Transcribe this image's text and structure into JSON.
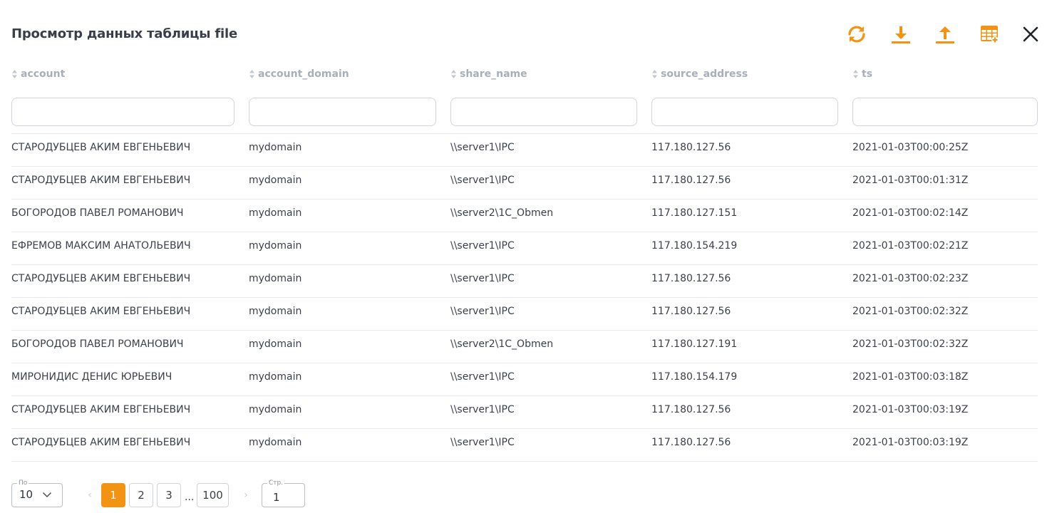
{
  "title": "Просмотр данных таблицы file",
  "toolbar": {
    "icons": [
      "refresh-icon",
      "download-icon",
      "upload-icon",
      "table-add-icon",
      "close-icon"
    ],
    "accent": "#f39314"
  },
  "columns": [
    "account",
    "account_domain",
    "share_name",
    "source_address",
    "ts"
  ],
  "rows": [
    [
      "СТАРОДУБЦЕВ АКИМ ЕВГЕНЬЕВИЧ",
      "mydomain",
      "\\\\server1\\IPC",
      "117.180.127.56",
      "2021-01-03T00:00:25Z"
    ],
    [
      "СТАРОДУБЦЕВ АКИМ ЕВГЕНЬЕВИЧ",
      "mydomain",
      "\\\\server1\\IPC",
      "117.180.127.56",
      "2021-01-03T00:01:31Z"
    ],
    [
      "БОГОРОДОВ ПАВЕЛ РОМАНОВИЧ",
      "mydomain",
      "\\\\server2\\1C_Obmen",
      "117.180.127.151",
      "2021-01-03T00:02:14Z"
    ],
    [
      "ЕФРЕМОВ МАКСИМ АНАТОЛЬЕВИЧ",
      "mydomain",
      "\\\\server1\\IPC",
      "117.180.154.219",
      "2021-01-03T00:02:21Z"
    ],
    [
      "СТАРОДУБЦЕВ АКИМ ЕВГЕНЬЕВИЧ",
      "mydomain",
      "\\\\server1\\IPC",
      "117.180.127.56",
      "2021-01-03T00:02:23Z"
    ],
    [
      "СТАРОДУБЦЕВ АКИМ ЕВГЕНЬЕВИЧ",
      "mydomain",
      "\\\\server1\\IPC",
      "117.180.127.56",
      "2021-01-03T00:02:32Z"
    ],
    [
      "БОГОРОДОВ ПАВЕЛ РОМАНОВИЧ",
      "mydomain",
      "\\\\server2\\1C_Obmen",
      "117.180.127.191",
      "2021-01-03T00:02:32Z"
    ],
    [
      "МИРОНИДИС ДЕНИС ЮРЬЕВИЧ",
      "mydomain",
      "\\\\server1\\IPC",
      "117.180.154.179",
      "2021-01-03T00:03:18Z"
    ],
    [
      "СТАРОДУБЦЕВ АКИМ ЕВГЕНЬЕВИЧ",
      "mydomain",
      "\\\\server1\\IPC",
      "117.180.127.56",
      "2021-01-03T00:03:19Z"
    ],
    [
      "СТАРОДУБЦЕВ АКИМ ЕВГЕНЬЕВИЧ",
      "mydomain",
      "\\\\server1\\IPC",
      "117.180.127.56",
      "2021-01-03T00:03:19Z"
    ]
  ],
  "pagination": {
    "per_page_label": "По",
    "per_page_value": "10",
    "prev_label": "‹",
    "pages": [
      "1",
      "2",
      "3"
    ],
    "ellipsis": "...",
    "last_page": "100",
    "next_label": "›",
    "current_page_label": "Стр.",
    "current_page_value": "1"
  }
}
